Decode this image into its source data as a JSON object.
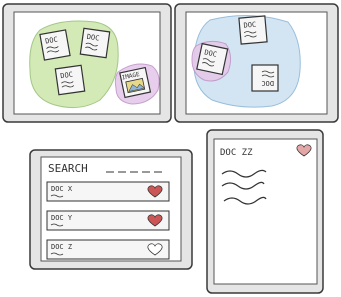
{
  "tablet_1": {
    "docs": [
      {
        "label": "DOC"
      },
      {
        "label": "DOC"
      },
      {
        "label": "DOC"
      }
    ],
    "image_label": "IMAGE"
  },
  "tablet_2": {
    "docs": [
      {
        "label": "DOC"
      },
      {
        "label": "DOC"
      },
      {
        "label": "DOC"
      }
    ]
  },
  "search_tablet": {
    "title": "SEARCH",
    "results": [
      {
        "label": "DOC X",
        "favorite": true
      },
      {
        "label": "DOC Y",
        "favorite": true
      },
      {
        "label": "DOC Z",
        "favorite": false
      }
    ]
  },
  "detail_tablet": {
    "title": "DOC ZZ",
    "favorite": true
  },
  "colors": {
    "frame": "#e5e5e5",
    "frame_stroke": "#3a3a3a",
    "screen": "#ffffff",
    "ink": "#333333",
    "green_blob": "#cfe8b0",
    "purple_blob": "#e5c9ea",
    "blue_blob": "#cfe3f2",
    "doc_fill": "#f6f6f6",
    "heart_red": "#cc5555",
    "heart_pink": "#e3a7a7",
    "image_fill": "#e8d98a"
  }
}
